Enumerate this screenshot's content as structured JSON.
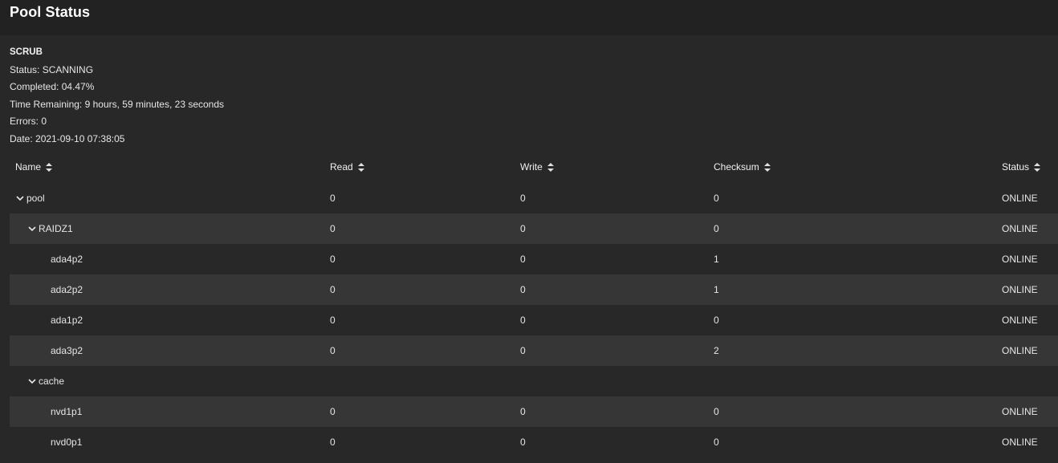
{
  "header": {
    "title": "Pool Status"
  },
  "scrub": {
    "title": "SCRUB",
    "status": "Status: SCANNING",
    "completed": "Completed: 04.47%",
    "time_remaining": "Time Remaining: 9 hours, 59 minutes, 23 seconds",
    "errors": "Errors: 0",
    "date": "Date: 2021-09-10 07:38:05"
  },
  "columns": {
    "name": "Name",
    "read": "Read",
    "write": "Write",
    "checksum": "Checksum",
    "status": "Status"
  },
  "rows": [
    {
      "name": "pool",
      "read": "0",
      "write": "0",
      "checksum": "0",
      "status": "ONLINE"
    },
    {
      "name": "RAIDZ1",
      "read": "0",
      "write": "0",
      "checksum": "0",
      "status": "ONLINE"
    },
    {
      "name": "ada4p2",
      "read": "0",
      "write": "0",
      "checksum": "1",
      "status": "ONLINE"
    },
    {
      "name": "ada2p2",
      "read": "0",
      "write": "0",
      "checksum": "1",
      "status": "ONLINE"
    },
    {
      "name": "ada1p2",
      "read": "0",
      "write": "0",
      "checksum": "0",
      "status": "ONLINE"
    },
    {
      "name": "ada3p2",
      "read": "0",
      "write": "0",
      "checksum": "2",
      "status": "ONLINE"
    },
    {
      "name": "cache"
    },
    {
      "name": "nvd1p1",
      "read": "0",
      "write": "0",
      "checksum": "0",
      "status": "ONLINE"
    },
    {
      "name": "nvd0p1",
      "read": "0",
      "write": "0",
      "checksum": "0",
      "status": "ONLINE"
    }
  ]
}
